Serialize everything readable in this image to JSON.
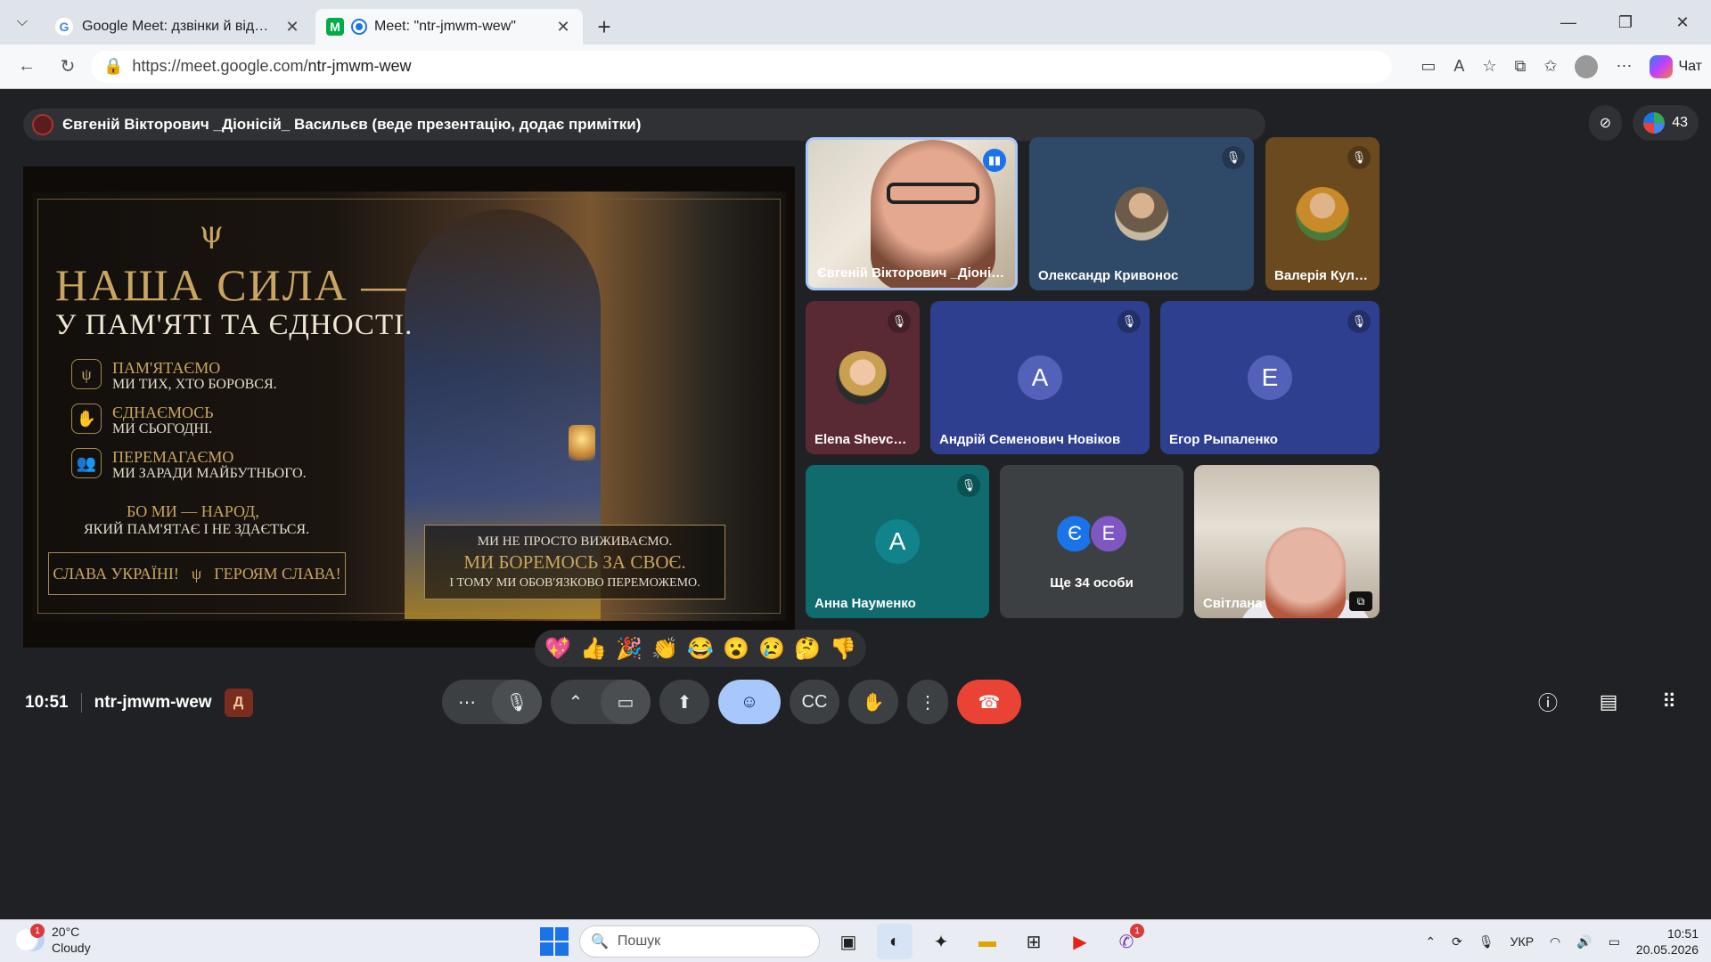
{
  "browser": {
    "tabs": [
      {
        "title": "Google Meet: дзвінки й відеоконф",
        "favicon": "G",
        "active": false
      },
      {
        "title": "Meet: \"ntr-jmwm-wew\"",
        "favicon": "M",
        "active": true
      }
    ],
    "url_domain": "https://meet.google.com/",
    "url_path": "ntr-jmwm-wew",
    "chat_label": "Чат"
  },
  "meet": {
    "presenter_text": "Євгеній Вікторович _Діонісій_ Васильєв (веде презентацію, додає примітки)",
    "participant_count": "43",
    "slide": {
      "title_line1": "НАША СИЛА —",
      "title_line2": "У ПАМ'ЯТІ ТА ЄДНОСТІ.",
      "items": [
        {
          "heading": "ПАМ'ЯТАЄМО",
          "sub": "МИ ТИХ, ХТО БОРОВСЯ.",
          "icon": "shield-trident-icon"
        },
        {
          "heading": "ЄДНАЄМОСЬ",
          "sub": "МИ СЬОГОДНІ.",
          "icon": "handshake-icon"
        },
        {
          "heading": "ПЕРЕМАГАЄМО",
          "sub": "МИ ЗАРАДИ МАЙБУТНЬОГО.",
          "icon": "people-icon"
        }
      ],
      "motto_line1": "БО МИ — НАРОД,",
      "motto_line2": "ЯКИЙ ПАМ'ЯТАЄ І НЕ ЗДАЄТЬСЯ.",
      "glory_left": "СЛАВА УКРАЇНІ!",
      "glory_right": "ГЕРОЯМ СЛАВА!",
      "quote_line1": "МИ НЕ ПРОСТО ВИЖИВАЄМО.",
      "quote_line2": "МИ БОРЕМОСЬ ЗА СВОЄ.",
      "quote_line3": "І ТОМУ МИ ОБОВ'ЯЗКОВО ПЕРЕМОЖЕМО."
    },
    "participants": [
      {
        "name": "Євгеній Вікторович _Діонісій_ Ва...",
        "type": "video",
        "speaking": true
      },
      {
        "name": "Олександр Кривонос",
        "type": "photo",
        "bg": "#2f4a68",
        "muted": true
      },
      {
        "name": "Валерія Кулак...",
        "type": "photo",
        "bg": "#6b4a1f",
        "muted": true
      },
      {
        "name": "Elena Shevche...",
        "type": "photo",
        "bg": "#5a2a34",
        "muted": true
      },
      {
        "name": "Андрій Семенович Новіков",
        "type": "letter",
        "letter": "А",
        "bg": "#2f3f8f",
        "avatar": "#5361b8",
        "muted": true
      },
      {
        "name": "Егор Рыпаленко",
        "type": "letter",
        "letter": "Е",
        "bg": "#2f3f8f",
        "avatar": "#5361b8",
        "muted": true
      },
      {
        "name": "Анна Науменко",
        "type": "letter",
        "letter": "А",
        "bg": "#0f6b6e",
        "avatar": "#10848a",
        "muted": true
      },
      {
        "name": "Світлана",
        "type": "video"
      }
    ],
    "more": {
      "label": "Ще 34 особи",
      "avatars": [
        {
          "letter": "Є",
          "color": "#1a73e8"
        },
        {
          "letter": "Е",
          "color": "#7e57c2"
        }
      ]
    },
    "reactions": [
      "💖",
      "👍",
      "🎉",
      "👏",
      "😂",
      "😮",
      "😢",
      "🤔",
      "👎"
    ],
    "time": "10:51",
    "meeting_code": "ntr-jmwm-wew"
  },
  "taskbar": {
    "weather_temp": "20°C",
    "weather_text": "Cloudy",
    "weather_badge": "1",
    "search_placeholder": "Пошук",
    "viber_badge": "1",
    "language": "УКР",
    "clock_time": "10:51",
    "clock_date": "20.05.2026"
  }
}
